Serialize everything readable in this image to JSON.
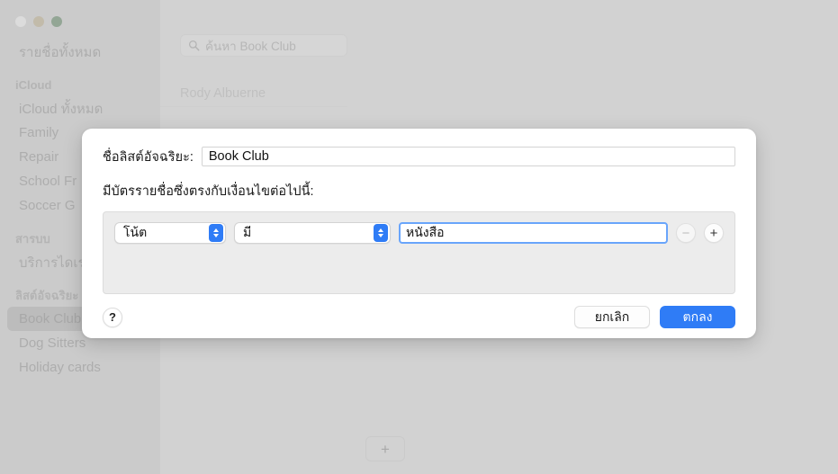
{
  "window": {
    "traffic_lights": [
      "close",
      "minimize",
      "zoom"
    ]
  },
  "sidebar": {
    "all_contacts": "รายชื่อทั้งหมด",
    "sections": [
      {
        "header": "iCloud",
        "items": [
          "iCloud ทั้งหมด",
          "Family",
          "Repair",
          "School Fr",
          "Soccer G"
        ]
      },
      {
        "header": "สารบบ",
        "items": [
          "บริการไดเร"
        ]
      },
      {
        "header": "ลิสต์อัจฉริยะ",
        "items": [
          "Book Club",
          "Dog Sitters",
          "Holiday cards"
        ],
        "selected": "Book Club"
      }
    ]
  },
  "content": {
    "search_placeholder": "ค้นหา Book Club",
    "contacts": [
      "Rody Albuerne"
    ],
    "add_button_label": "+"
  },
  "sheet": {
    "name_label": "ชื่อลิสต์อัจฉริยะ:",
    "name_value": "Book Club",
    "match_label": "มีบัตรรายชื่อซึ่งตรงกับเงื่อนไขต่อไปนี้:",
    "condition": {
      "field": "โน้ต",
      "operator": "มี",
      "value": "หนังสือ",
      "remove_label": "−",
      "add_label": "+"
    },
    "help_label": "?",
    "cancel_label": "ยกเลิก",
    "ok_label": "ตกลง"
  },
  "colors": {
    "accent": "#2f7cf6",
    "focus_ring": "#69a5fb",
    "sheet_bg": "#ffffff",
    "desktop_bg": "#c9c9c9"
  }
}
